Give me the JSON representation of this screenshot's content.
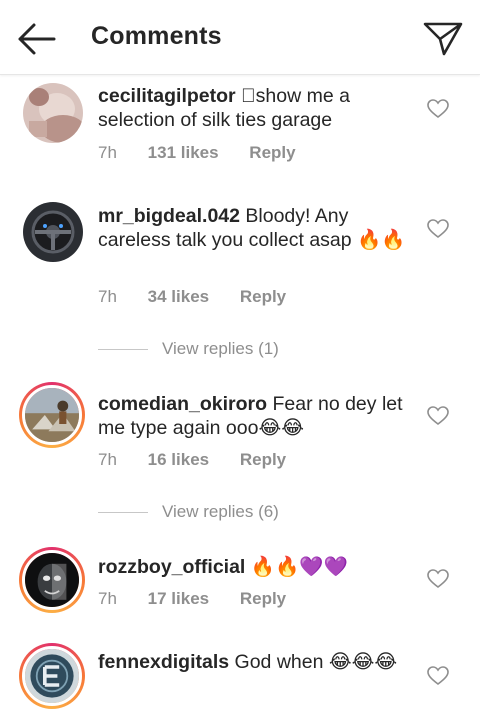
{
  "header": {
    "title": "Comments",
    "back_icon": "arrow-left-icon",
    "send_icon": "paper-plane-icon"
  },
  "comments": [
    {
      "username": "cecilitagilpetor",
      "text": "􏰀show me a selection of silk ties garage",
      "time": "7h",
      "likes": "131 likes",
      "reply": "Reply",
      "avatar": "avatar-photo",
      "has_story_ring": false
    },
    {
      "username": "mr_bigdeal.042",
      "text": "Bloody! Any careless talk you collect asap 🔥🔥",
      "time": "7h",
      "likes": "34 likes",
      "reply": "Reply",
      "avatar": "avatar-photo",
      "has_story_ring": false
    },
    {
      "username": "comedian_okiroro",
      "text": "Fear no dey let me type again ooo😂😂",
      "time": "7h",
      "likes": "16 likes",
      "reply": "Reply",
      "avatar": "avatar-photo",
      "has_story_ring": true
    },
    {
      "username": "rozzboy_official",
      "text": "🔥🔥💜💜",
      "time": "7h",
      "likes": "17 likes",
      "reply": "Reply",
      "avatar": "avatar-photo",
      "has_story_ring": true
    },
    {
      "username": "fennexdigitals",
      "text": "God when 😂😂😂",
      "avatar": "avatar-photo",
      "has_story_ring": true
    }
  ],
  "view_replies": [
    {
      "label": "View replies (1)"
    },
    {
      "label": "View replies (6)"
    }
  ],
  "colors": {
    "text": "#262626",
    "secondary": "#8e8e8e",
    "fire": "#f77737",
    "heart_purple": "#8a2be2"
  }
}
